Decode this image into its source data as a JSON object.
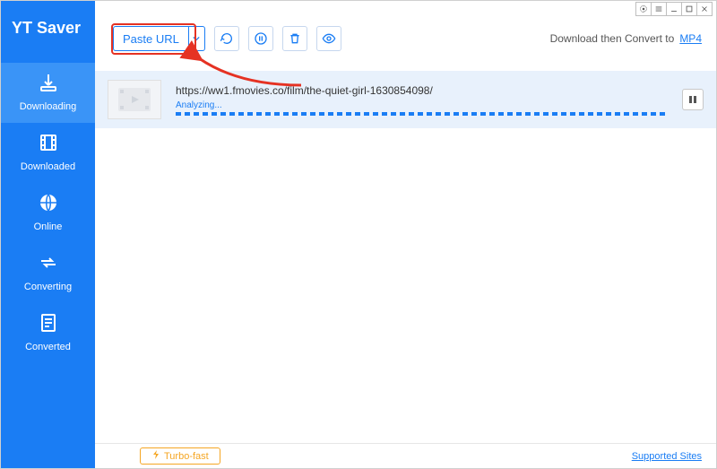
{
  "brand": "YT Saver",
  "sidebar": {
    "items": [
      {
        "label": "Downloading",
        "icon": "download"
      },
      {
        "label": "Downloaded",
        "icon": "film"
      },
      {
        "label": "Online",
        "icon": "globe"
      },
      {
        "label": "Converting",
        "icon": "cycle"
      },
      {
        "label": "Converted",
        "icon": "document"
      }
    ],
    "activeIndex": 0
  },
  "toolbar": {
    "paste_label": "Paste URL",
    "convert_text": "Download then Convert to",
    "format": "MP4"
  },
  "downloads": [
    {
      "url": "https://ww1.fmovies.co/film/the-quiet-girl-1630854098/",
      "status": "Analyzing..."
    }
  ],
  "footer": {
    "turbo_label": "Turbo-fast",
    "supported_label": "Supported Sites"
  }
}
